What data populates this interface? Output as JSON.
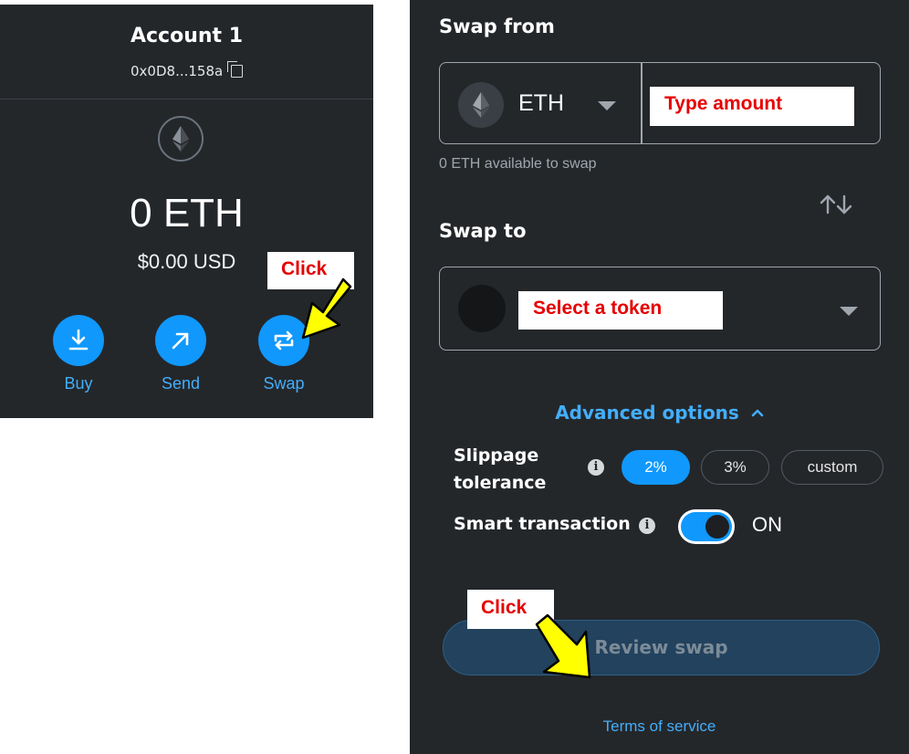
{
  "wallet": {
    "account_name": "Account 1",
    "address": "0x0D8...158a",
    "balance_primary": "0 ETH",
    "balance_secondary": "$0.00 USD",
    "actions": [
      {
        "label": "Buy",
        "icon": "download-icon"
      },
      {
        "label": "Send",
        "icon": "arrow-up-right-icon"
      },
      {
        "label": "Swap",
        "icon": "swap-arrows-icon"
      }
    ],
    "accent_color": "#1098fc"
  },
  "swap": {
    "from_title": "Swap from",
    "from_token": "ETH",
    "available": "0 ETH available to swap",
    "to_title": "Swap to",
    "advanced_options": "Advanced options",
    "slippage_label_line1": "Slippage",
    "slippage_label_line2": "tolerance",
    "slippage_options": [
      "2%",
      "3%",
      "custom"
    ],
    "slippage_selected": "2%",
    "smart_transaction_label": "Smart transaction",
    "smart_transaction_state": "ON",
    "review_button": "Review swap",
    "terms": "Terms of service",
    "background_color": "#24272a"
  },
  "annotations": {
    "type_amount": "Type amount",
    "select_token": "Select a token",
    "click_swap": "Click",
    "click_review": "Click",
    "arrow_color": "#ffff00"
  }
}
